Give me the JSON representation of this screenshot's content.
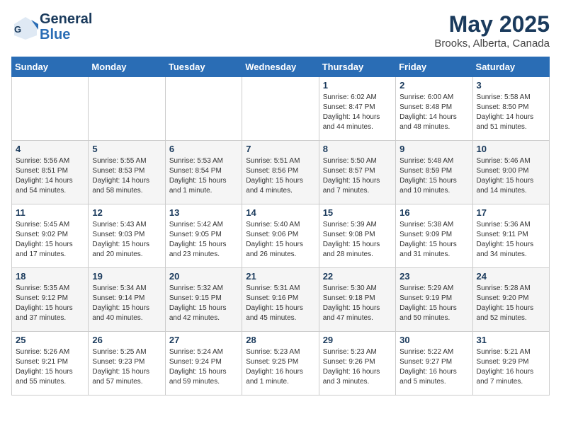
{
  "header": {
    "logo_line1": "General",
    "logo_line2": "Blue",
    "month_year": "May 2025",
    "location": "Brooks, Alberta, Canada"
  },
  "weekdays": [
    "Sunday",
    "Monday",
    "Tuesday",
    "Wednesday",
    "Thursday",
    "Friday",
    "Saturday"
  ],
  "weeks": [
    [
      {
        "day": "",
        "info": ""
      },
      {
        "day": "",
        "info": ""
      },
      {
        "day": "",
        "info": ""
      },
      {
        "day": "",
        "info": ""
      },
      {
        "day": "1",
        "info": "Sunrise: 6:02 AM\nSunset: 8:47 PM\nDaylight: 14 hours\nand 44 minutes."
      },
      {
        "day": "2",
        "info": "Sunrise: 6:00 AM\nSunset: 8:48 PM\nDaylight: 14 hours\nand 48 minutes."
      },
      {
        "day": "3",
        "info": "Sunrise: 5:58 AM\nSunset: 8:50 PM\nDaylight: 14 hours\nand 51 minutes."
      }
    ],
    [
      {
        "day": "4",
        "info": "Sunrise: 5:56 AM\nSunset: 8:51 PM\nDaylight: 14 hours\nand 54 minutes."
      },
      {
        "day": "5",
        "info": "Sunrise: 5:55 AM\nSunset: 8:53 PM\nDaylight: 14 hours\nand 58 minutes."
      },
      {
        "day": "6",
        "info": "Sunrise: 5:53 AM\nSunset: 8:54 PM\nDaylight: 15 hours\nand 1 minute."
      },
      {
        "day": "7",
        "info": "Sunrise: 5:51 AM\nSunset: 8:56 PM\nDaylight: 15 hours\nand 4 minutes."
      },
      {
        "day": "8",
        "info": "Sunrise: 5:50 AM\nSunset: 8:57 PM\nDaylight: 15 hours\nand 7 minutes."
      },
      {
        "day": "9",
        "info": "Sunrise: 5:48 AM\nSunset: 8:59 PM\nDaylight: 15 hours\nand 10 minutes."
      },
      {
        "day": "10",
        "info": "Sunrise: 5:46 AM\nSunset: 9:00 PM\nDaylight: 15 hours\nand 14 minutes."
      }
    ],
    [
      {
        "day": "11",
        "info": "Sunrise: 5:45 AM\nSunset: 9:02 PM\nDaylight: 15 hours\nand 17 minutes."
      },
      {
        "day": "12",
        "info": "Sunrise: 5:43 AM\nSunset: 9:03 PM\nDaylight: 15 hours\nand 20 minutes."
      },
      {
        "day": "13",
        "info": "Sunrise: 5:42 AM\nSunset: 9:05 PM\nDaylight: 15 hours\nand 23 minutes."
      },
      {
        "day": "14",
        "info": "Sunrise: 5:40 AM\nSunset: 9:06 PM\nDaylight: 15 hours\nand 26 minutes."
      },
      {
        "day": "15",
        "info": "Sunrise: 5:39 AM\nSunset: 9:08 PM\nDaylight: 15 hours\nand 28 minutes."
      },
      {
        "day": "16",
        "info": "Sunrise: 5:38 AM\nSunset: 9:09 PM\nDaylight: 15 hours\nand 31 minutes."
      },
      {
        "day": "17",
        "info": "Sunrise: 5:36 AM\nSunset: 9:11 PM\nDaylight: 15 hours\nand 34 minutes."
      }
    ],
    [
      {
        "day": "18",
        "info": "Sunrise: 5:35 AM\nSunset: 9:12 PM\nDaylight: 15 hours\nand 37 minutes."
      },
      {
        "day": "19",
        "info": "Sunrise: 5:34 AM\nSunset: 9:14 PM\nDaylight: 15 hours\nand 40 minutes."
      },
      {
        "day": "20",
        "info": "Sunrise: 5:32 AM\nSunset: 9:15 PM\nDaylight: 15 hours\nand 42 minutes."
      },
      {
        "day": "21",
        "info": "Sunrise: 5:31 AM\nSunset: 9:16 PM\nDaylight: 15 hours\nand 45 minutes."
      },
      {
        "day": "22",
        "info": "Sunrise: 5:30 AM\nSunset: 9:18 PM\nDaylight: 15 hours\nand 47 minutes."
      },
      {
        "day": "23",
        "info": "Sunrise: 5:29 AM\nSunset: 9:19 PM\nDaylight: 15 hours\nand 50 minutes."
      },
      {
        "day": "24",
        "info": "Sunrise: 5:28 AM\nSunset: 9:20 PM\nDaylight: 15 hours\nand 52 minutes."
      }
    ],
    [
      {
        "day": "25",
        "info": "Sunrise: 5:26 AM\nSunset: 9:21 PM\nDaylight: 15 hours\nand 55 minutes."
      },
      {
        "day": "26",
        "info": "Sunrise: 5:25 AM\nSunset: 9:23 PM\nDaylight: 15 hours\nand 57 minutes."
      },
      {
        "day": "27",
        "info": "Sunrise: 5:24 AM\nSunset: 9:24 PM\nDaylight: 15 hours\nand 59 minutes."
      },
      {
        "day": "28",
        "info": "Sunrise: 5:23 AM\nSunset: 9:25 PM\nDaylight: 16 hours\nand 1 minute."
      },
      {
        "day": "29",
        "info": "Sunrise: 5:23 AM\nSunset: 9:26 PM\nDaylight: 16 hours\nand 3 minutes."
      },
      {
        "day": "30",
        "info": "Sunrise: 5:22 AM\nSunset: 9:27 PM\nDaylight: 16 hours\nand 5 minutes."
      },
      {
        "day": "31",
        "info": "Sunrise: 5:21 AM\nSunset: 9:29 PM\nDaylight: 16 hours\nand 7 minutes."
      }
    ]
  ]
}
